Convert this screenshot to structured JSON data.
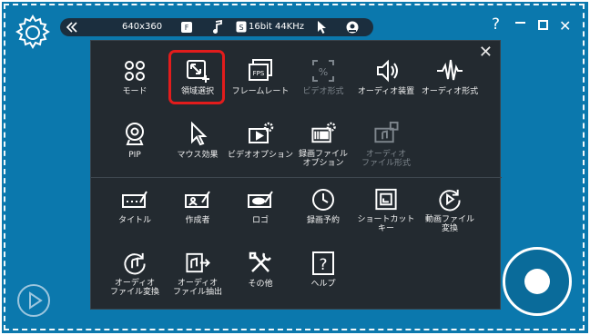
{
  "topbar": {
    "resolution": "640x360",
    "audio_format": "16bit 44KHz"
  },
  "window": {
    "help": "?",
    "close": "✕"
  },
  "menu": {
    "close": "✕",
    "row1": [
      {
        "label": "モード",
        "icon": "grid-icon",
        "disabled": false
      },
      {
        "label": "領域選択",
        "icon": "area-select-icon",
        "disabled": false
      },
      {
        "label": "フレームレート",
        "icon": "fps-icon",
        "disabled": false
      },
      {
        "label": "ビデオ形式",
        "icon": "video-format-icon",
        "disabled": true
      },
      {
        "label": "オーディオ装置",
        "icon": "speaker-icon",
        "disabled": false
      },
      {
        "label": "オーディオ形式",
        "icon": "waveform-icon",
        "disabled": false
      }
    ],
    "row2": [
      {
        "label": "PIP",
        "icon": "webcam-icon",
        "disabled": false
      },
      {
        "label": "マウス効果",
        "icon": "cursor-icon",
        "disabled": false
      },
      {
        "label": "ビデオオプション",
        "icon": "video-options-icon",
        "disabled": false
      },
      {
        "label1": "録画ファイル",
        "label2": "オプション",
        "icon": "record-file-options-icon",
        "disabled": false
      },
      {
        "label1": "オーディオ",
        "label2": "ファイル形式",
        "icon": "audio-file-format-icon",
        "disabled": true
      }
    ],
    "row3": [
      {
        "label": "タイトル",
        "icon": "title-icon"
      },
      {
        "label": "作成者",
        "icon": "author-icon"
      },
      {
        "label": "ロゴ",
        "icon": "logo-icon"
      },
      {
        "label": "録画予約",
        "icon": "clock-icon"
      },
      {
        "label1": "ショートカット",
        "label2": "キー",
        "icon": "shortcut-icon"
      },
      {
        "label1": "動画ファイル",
        "label2": "変換",
        "icon": "video-convert-icon"
      }
    ],
    "row4": [
      {
        "label1": "オーディオ",
        "label2": "ファイル変換",
        "icon": "audio-convert-icon"
      },
      {
        "label1": "オーディオ",
        "label2": "ファイル抽出",
        "icon": "audio-extract-icon"
      },
      {
        "label": "その他",
        "icon": "tools-icon"
      },
      {
        "label": "ヘルプ",
        "icon": "help-icon"
      }
    ]
  }
}
